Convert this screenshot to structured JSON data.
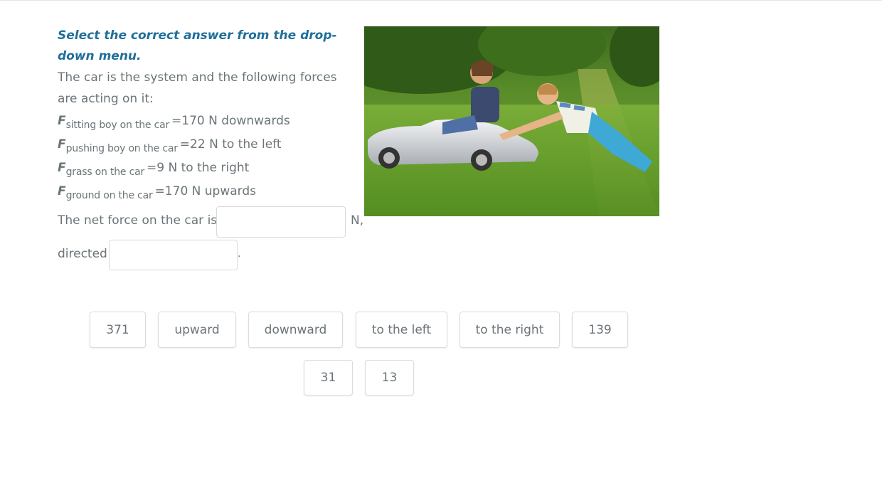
{
  "instruction": "Select the correct answer from the drop-down menu.",
  "stem": "The car is the system and the following forces are acting on it:",
  "forces": [
    {
      "symbol": "F",
      "subscript": "sitting boy on the car",
      "value": "=170 N downwards"
    },
    {
      "symbol": "F",
      "subscript": "pushing boy on the car",
      "value": "=22 N to the left"
    },
    {
      "symbol": "F",
      "subscript": "grass on the car",
      "value": "=9 N to the right"
    },
    {
      "symbol": "F",
      "subscript": "ground on the car",
      "value": "=170 N upwards"
    }
  ],
  "answer": {
    "prefix": "The net force on the car is",
    "unit_suffix": "N,",
    "direction_prefix": "directed",
    "end_punct": "."
  },
  "options": [
    {
      "label": "371"
    },
    {
      "label": "upward"
    },
    {
      "label": "downward"
    },
    {
      "label": "to the left"
    },
    {
      "label": "to the right"
    },
    {
      "label": "139"
    },
    {
      "label": "31"
    },
    {
      "label": "13"
    }
  ],
  "image_icon": "children-pedal-car-photo"
}
